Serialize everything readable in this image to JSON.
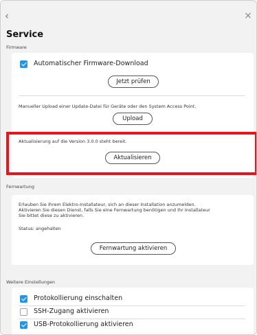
{
  "nav": {
    "back_glyph": "‹",
    "close_glyph": "×"
  },
  "page": {
    "title": "Service"
  },
  "firmware": {
    "section_label": "Firmware",
    "auto_download_label": "Automatischer Firmware-Download",
    "auto_download_checked": true,
    "check_button": "Jetzt prüfen",
    "manual_upload_text": "Manueller Upload einer Update-Datei für Geräte oder den System Access Point.",
    "upload_button": "Upload",
    "update_text": "Aktualisierung auf die Version 3.0.0 steht bereit.",
    "update_button": "Aktualisieren"
  },
  "remote": {
    "section_label": "Fernwartung",
    "description_line1": "Erlauben Sie Ihrem Elektro-Installateur, sich an dieser Installation anzumelden.",
    "description_line2": "Aktivieren Sie diesen Dienst, falls Sie eine Fernwartung benötigen und Ihr Installateur",
    "description_line3": "Sie bittet diese zu aktivieren.",
    "status_text": "Status: angehalten",
    "activate_button": "Fernwartung aktivieren"
  },
  "more": {
    "section_label": "Weitere Einstellungen",
    "items": [
      {
        "label": "Protokollierung einschalten",
        "checked": true
      },
      {
        "label": "SSH-Zugang aktivieren",
        "checked": false
      },
      {
        "label": "USB-Protokollierung aktivieren",
        "checked": true
      }
    ]
  },
  "colors": {
    "accent": "#2196e8",
    "highlight": "#e8141b",
    "background": "#f2f2f2"
  }
}
